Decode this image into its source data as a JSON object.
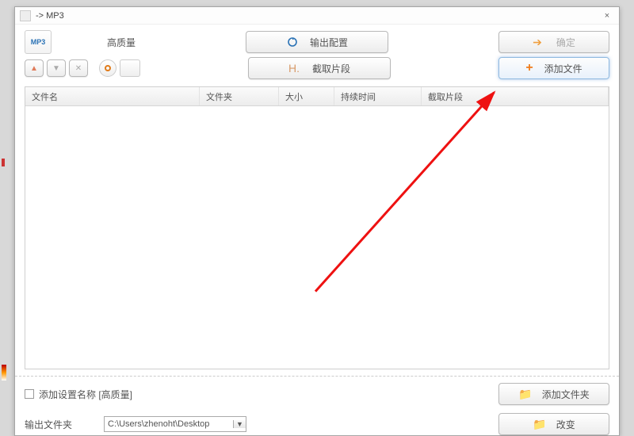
{
  "title": "-> MP3",
  "quality": "高质量",
  "buttons": {
    "output_config": "输出配置",
    "ok": "确定",
    "clip": "截取片段",
    "add_file": "添加文件",
    "add_folder": "添加文件夹",
    "change": "改变"
  },
  "columns": {
    "filename": "文件名",
    "folder": "文件夹",
    "size": "大小",
    "duration": "持续时间",
    "clips": "截取片段"
  },
  "bottom": {
    "add_setting_checkbox": "添加设置名称 [高质量]",
    "output_label": "输出文件夹",
    "output_path": "C:\\Users\\zhenoht\\Desktop"
  }
}
